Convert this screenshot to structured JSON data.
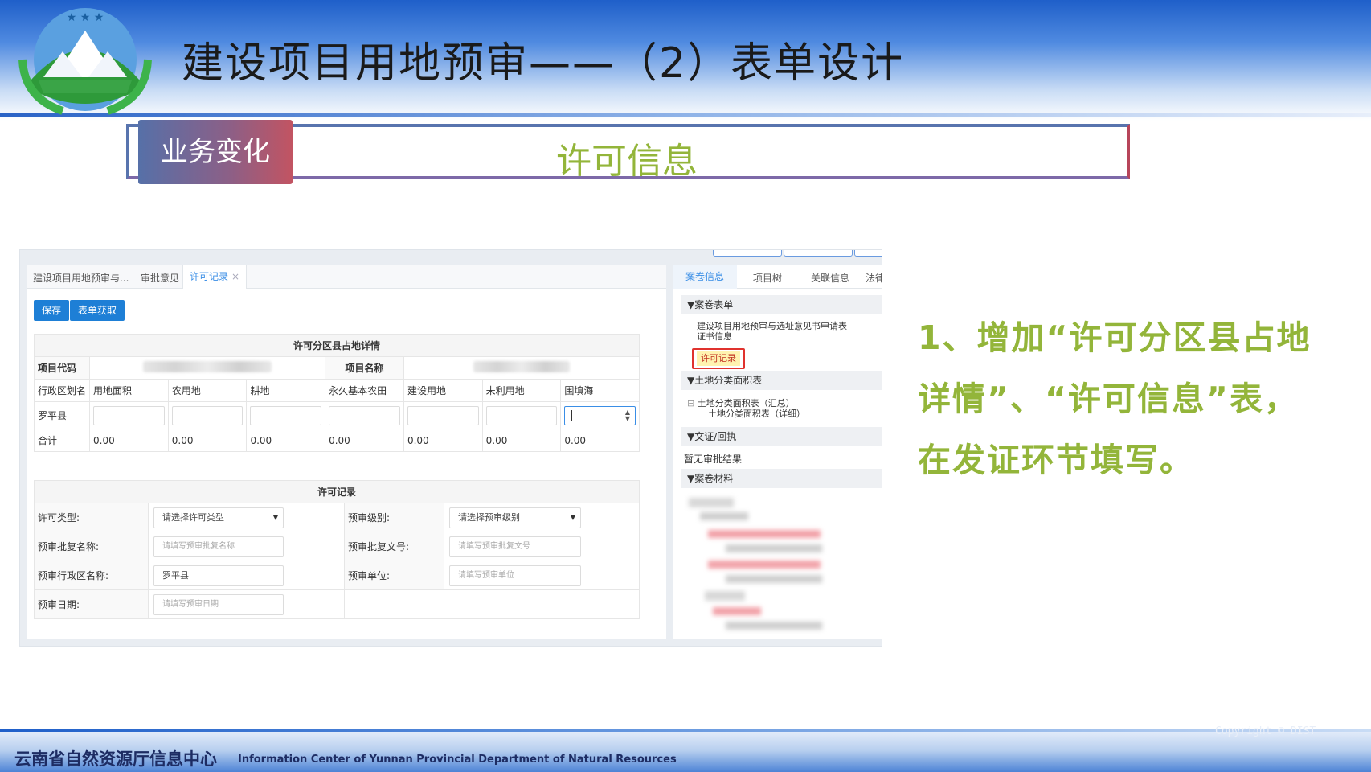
{
  "slide": {
    "title": "建设项目用地预审——（2）表单设计",
    "section_tag": "业务变化",
    "section_title": "许可信息",
    "note_lines": [
      "1、增加“许可分区县占地",
      "详情”、“许可信息”表，",
      "在发证环节填写。"
    ],
    "footer_cn": "云南省自然资源厅信息中心",
    "footer_en": "Information Center  of Yunnan Provincial Department of Natural Resources",
    "copyright": "Copyright © DIST"
  },
  "app": {
    "tabs": [
      {
        "label": "建设项目用地预审与..."
      },
      {
        "label": "审批意见"
      },
      {
        "label": "许可记录",
        "close": "×"
      }
    ],
    "buttons": {
      "save": "保存",
      "fetch": "表单获取"
    },
    "table1": {
      "caption": "许可分区县占地详情",
      "project_code_label": "项目代码",
      "project_name_label": "项目名称",
      "columns": [
        "行政区划名",
        "用地面积",
        "农用地",
        "耕地",
        "永久基本农田",
        "建设用地",
        "未利用地",
        "围填海"
      ],
      "row_name": "罗平县",
      "total_label": "合计",
      "totals": [
        "0.00",
        "0.00",
        "0.00",
        "0.00",
        "0.00",
        "0.00",
        "0.00"
      ]
    },
    "table2": {
      "caption": "许可记录",
      "license_type_label": "许可类型:",
      "license_type_value": "请选择许可类型",
      "level_label": "预审级别:",
      "level_value": "请选择预审级别",
      "reply_name_label": "预审批复名称:",
      "reply_name_ph": "请填写预审批复名称",
      "reply_no_label": "预审批复文号:",
      "reply_no_ph": "请填写预审批复文号",
      "region_label": "预审行政区名称:",
      "region_value": "罗平县",
      "unit_label": "预审单位:",
      "unit_ph": "请填写预审单位",
      "date_label": "预审日期:",
      "date_ph": "请填写预审日期"
    },
    "right": {
      "tabs": [
        "案卷信息",
        "项目树",
        "关联信息",
        "法律法"
      ],
      "sections": {
        "forms": "▼案卷表单",
        "land": "▼土地分类面积表",
        "docs": "▼文证/回执",
        "materials": "▼案卷材料"
      },
      "form_item_line1": "建设项目用地预审与选址意见书申请表",
      "form_item_line2": "证书信息",
      "form_item_highlight": "许可记录",
      "land_item1": "土地分类面积表（汇总）",
      "land_item2": "土地分类面积表（详细）",
      "no_result": "暂无审批结果"
    }
  }
}
